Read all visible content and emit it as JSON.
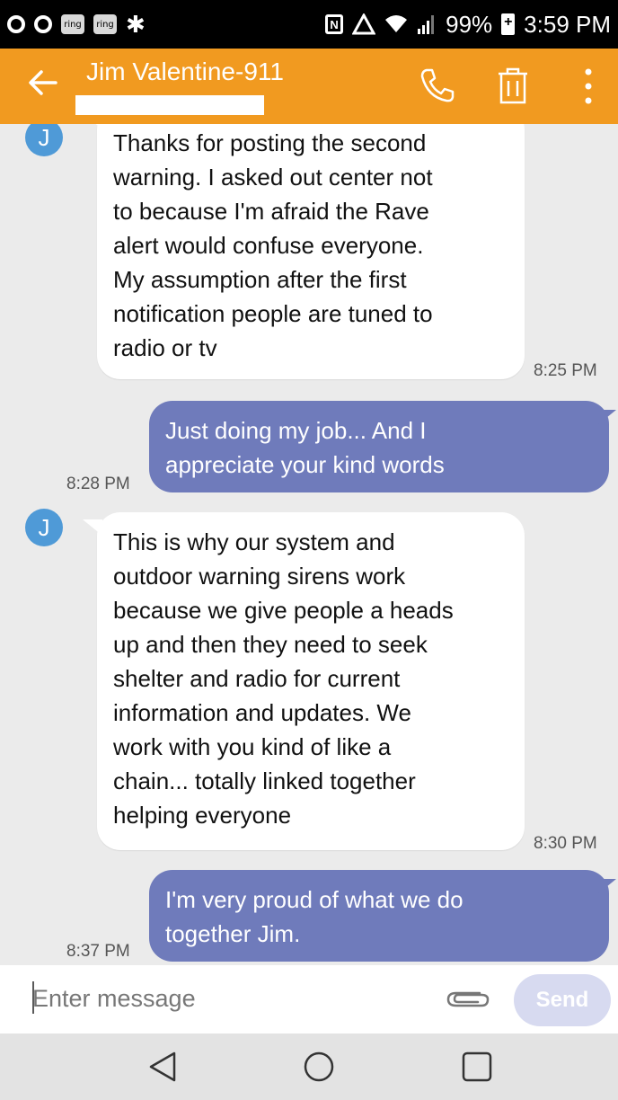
{
  "status_bar": {
    "notification_apps": [
      "ring",
      "ring"
    ],
    "battery": "99%",
    "time": "3:59 PM"
  },
  "header": {
    "contact_name": "Jim Valentine-911",
    "back_icon": "arrow-back-icon",
    "call_icon": "phone-icon",
    "delete_icon": "trash-icon",
    "menu_icon": "more-vert-icon",
    "bar_color": "#f19a20"
  },
  "conversation": {
    "avatar_letter": "J",
    "messages": [
      {
        "direction": "incoming",
        "lines": [
          "Thanks for posting the second",
          "warning. I asked out center not",
          "to because I'm afraid the Rave",
          "alert would confuse everyone.",
          "My assumption after the first",
          "notification people are tuned to",
          "radio or tv"
        ],
        "time": "8:25 PM"
      },
      {
        "direction": "outgoing",
        "lines": [
          "Just doing my job... And I",
          "appreciate your kind words"
        ],
        "time": "8:28 PM"
      },
      {
        "direction": "incoming",
        "lines": [
          "This is why our system and",
          "outdoor warning sirens work",
          "because we give people a heads",
          "up and then they need to seek",
          "shelter and radio for current",
          "information and updates. We",
          "work with you kind of like a",
          "chain... totally linked together",
          "helping everyone"
        ],
        "time": "8:30 PM"
      },
      {
        "direction": "outgoing",
        "lines": [
          "I'm very proud of what we do",
          "together Jim."
        ],
        "time": "8:37 PM"
      }
    ],
    "incoming_color": "#ffffff",
    "outgoing_color": "#6f7bbb",
    "avatar_color": "#4f9ad7"
  },
  "composer": {
    "placeholder": "Enter message",
    "value": "",
    "attach_icon": "paperclip-icon",
    "send_label": "Send"
  },
  "nav_bar": {
    "back_icon": "nav-back-icon",
    "home_icon": "nav-home-icon",
    "recents_icon": "nav-recents-icon"
  }
}
